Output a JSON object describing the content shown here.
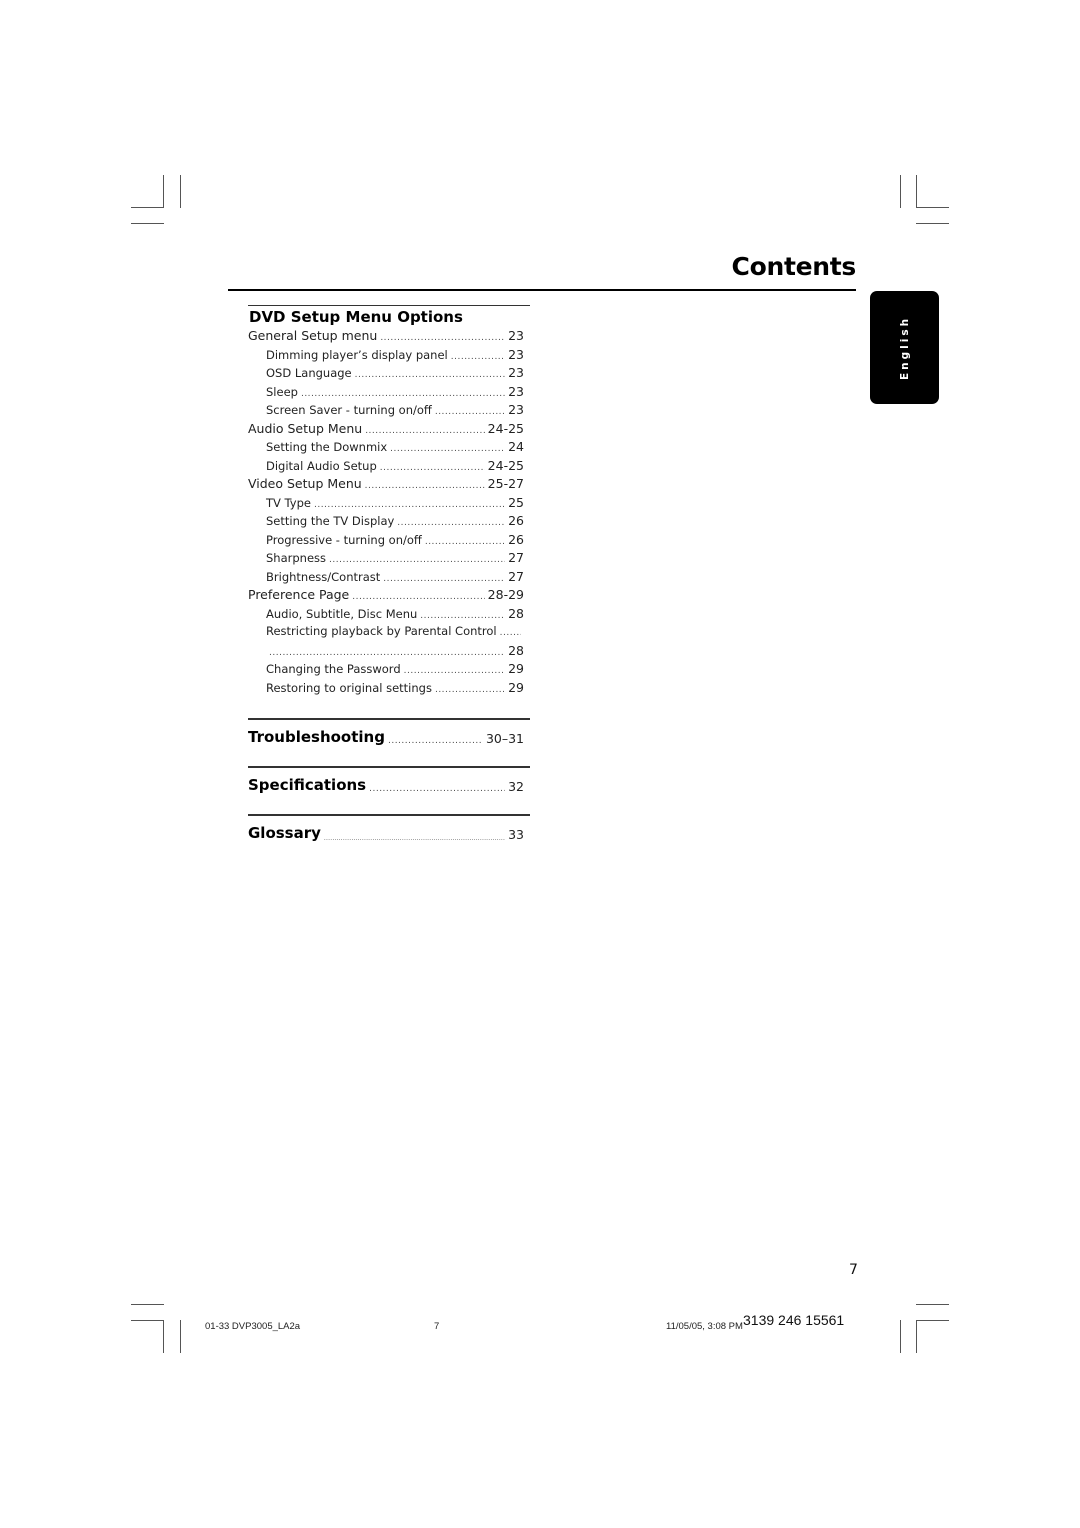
{
  "header": {
    "title": "Contents"
  },
  "language_tab": {
    "label": "English"
  },
  "sections": [
    {
      "title": "DVD Setup Menu Options",
      "entries": [
        {
          "label": "General Setup menu",
          "page": "23",
          "level": 1
        },
        {
          "label": "Dimming player’s display panel",
          "page": "23",
          "level": 2
        },
        {
          "label": "OSD Language",
          "page": "23",
          "level": 2
        },
        {
          "label": "Sleep",
          "page": "23",
          "level": 2
        },
        {
          "label": "Screen Saver - turning on/off",
          "page": "23",
          "level": 2
        },
        {
          "label": "Audio Setup Menu",
          "page": "24-25",
          "level": 1
        },
        {
          "label": "Setting the Downmix",
          "page": "24",
          "level": 2
        },
        {
          "label": "Digital Audio Setup",
          "page": "24-25",
          "level": 2
        },
        {
          "label": "Video Setup Menu",
          "page": "25-27",
          "level": 1
        },
        {
          "label": "TV Type",
          "page": "25",
          "level": 2
        },
        {
          "label": "Setting the TV Display",
          "page": "26",
          "level": 2
        },
        {
          "label": "Progressive - turning on/off",
          "page": "26",
          "level": 2
        },
        {
          "label": "Sharpness",
          "page": "27",
          "level": 2
        },
        {
          "label": "Brightness/Contrast",
          "page": "27",
          "level": 2
        },
        {
          "label": "Preference Page",
          "page": "28-29",
          "level": 1
        },
        {
          "label": "Audio, Subtitle, Disc Menu",
          "page": "28",
          "level": 2
        },
        {
          "label": "Restricting playback by Parental Control",
          "page": "",
          "level": 2
        },
        {
          "label": "",
          "page": "28",
          "level": 2
        },
        {
          "label": "Changing the Password",
          "page": "29",
          "level": 2
        },
        {
          "label": "Restoring to original settings",
          "page": "29",
          "level": 2
        }
      ]
    }
  ],
  "major_sections": [
    {
      "label": "Troubleshooting",
      "page": "30–31"
    },
    {
      "label": "Specifications",
      "page": "32"
    },
    {
      "label": "Glossary",
      "page": "33"
    }
  ],
  "footer": {
    "page_number": "7",
    "file_name": "01-33 DVP3005_LA2a",
    "sheet_number": "7",
    "timestamp": "11/05/05, 3:08 PM",
    "part_number": "3139 246 15561"
  }
}
